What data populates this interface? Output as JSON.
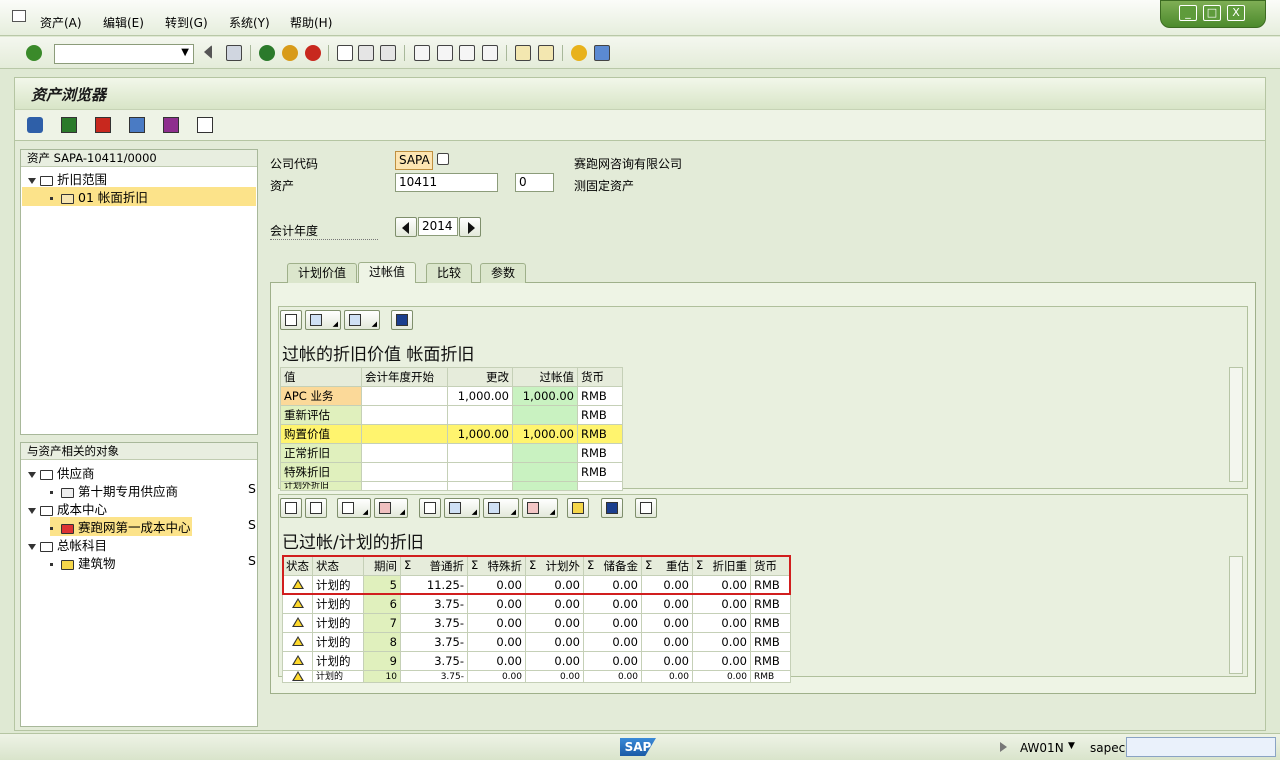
{
  "menu": {
    "items": [
      "资产(A)",
      "编辑(E)",
      "转到(G)",
      "系统(Y)",
      "帮助(H)"
    ]
  },
  "window": {
    "controls": [
      "_",
      "□",
      "X"
    ]
  },
  "page": {
    "title": "资产浏览器"
  },
  "tree1": {
    "header": "资产 SAPA-10411/0000",
    "items": [
      {
        "label": "折旧范围"
      },
      {
        "label": "01 帐面折旧"
      }
    ]
  },
  "tree2": {
    "header": "与资产相关的对象",
    "items": [
      {
        "label": "供应商"
      },
      {
        "label": "第十期专用供应商",
        "tag": "S"
      },
      {
        "label": "成本中心"
      },
      {
        "label": "赛跑网第一成本中心",
        "tag": "S"
      },
      {
        "label": "总帐科目"
      },
      {
        "label": "建筑物",
        "tag": "S"
      }
    ]
  },
  "form": {
    "company_code_label": "公司代码",
    "company_code": "SAPA",
    "company_name": "赛跑网咨询有限公司",
    "asset_label": "资产",
    "asset": "10411",
    "sub_number": "0",
    "asset_desc": "测固定资产",
    "fiscal_year_label": "会计年度",
    "fiscal_year": "2014"
  },
  "tabs": [
    "计划价值",
    "过帐值",
    "比较",
    "参数"
  ],
  "section1": {
    "title": "过帐的折旧价值 帐面折旧",
    "columns": [
      "值",
      "会计年度开始",
      "更改",
      "过帐值",
      "货币"
    ],
    "rows": [
      [
        "APC 业务",
        "",
        "1,000.00",
        "1,000.00",
        "RMB"
      ],
      [
        "重新评估",
        "",
        "",
        "",
        "RMB"
      ],
      [
        "购置价值",
        "",
        "1,000.00",
        "1,000.00",
        "RMB"
      ],
      [
        "正常折旧",
        "",
        "",
        "",
        "RMB"
      ],
      [
        "特殊折旧",
        "",
        "",
        "",
        "RMB"
      ],
      [
        "计划外折旧",
        "",
        "",
        "",
        ""
      ]
    ]
  },
  "section2": {
    "title": "已过帐/计划的折旧",
    "columns": [
      "状态",
      "状态",
      "期间",
      "普通折",
      "特殊折",
      "计划外",
      "储备金",
      "重估",
      "折旧重",
      "货币"
    ],
    "sigma": "Σ",
    "rows": [
      [
        "计划的",
        "5",
        "11.25-",
        "0.00",
        "0.00",
        "0.00",
        "0.00",
        "0.00",
        "RMB"
      ],
      [
        "计划的",
        "6",
        "3.75-",
        "0.00",
        "0.00",
        "0.00",
        "0.00",
        "0.00",
        "RMB"
      ],
      [
        "计划的",
        "7",
        "3.75-",
        "0.00",
        "0.00",
        "0.00",
        "0.00",
        "0.00",
        "RMB"
      ],
      [
        "计划的",
        "8",
        "3.75-",
        "0.00",
        "0.00",
        "0.00",
        "0.00",
        "0.00",
        "RMB"
      ],
      [
        "计划的",
        "9",
        "3.75-",
        "0.00",
        "0.00",
        "0.00",
        "0.00",
        "0.00",
        "RMB"
      ],
      [
        "计划的",
        "10",
        "3.75-",
        "0.00",
        "0.00",
        "0.00",
        "0.00",
        "0.00",
        "RMB"
      ]
    ]
  },
  "status": {
    "logo": "SAP",
    "tcode": "AW01N",
    "system": "sapecc"
  },
  "colors": {
    "accent": "#4c8a2c",
    "highlight": "#fce38a",
    "yellow": "#fff46e",
    "green": "#c9f2c1",
    "red_box": "#d11e1e"
  }
}
